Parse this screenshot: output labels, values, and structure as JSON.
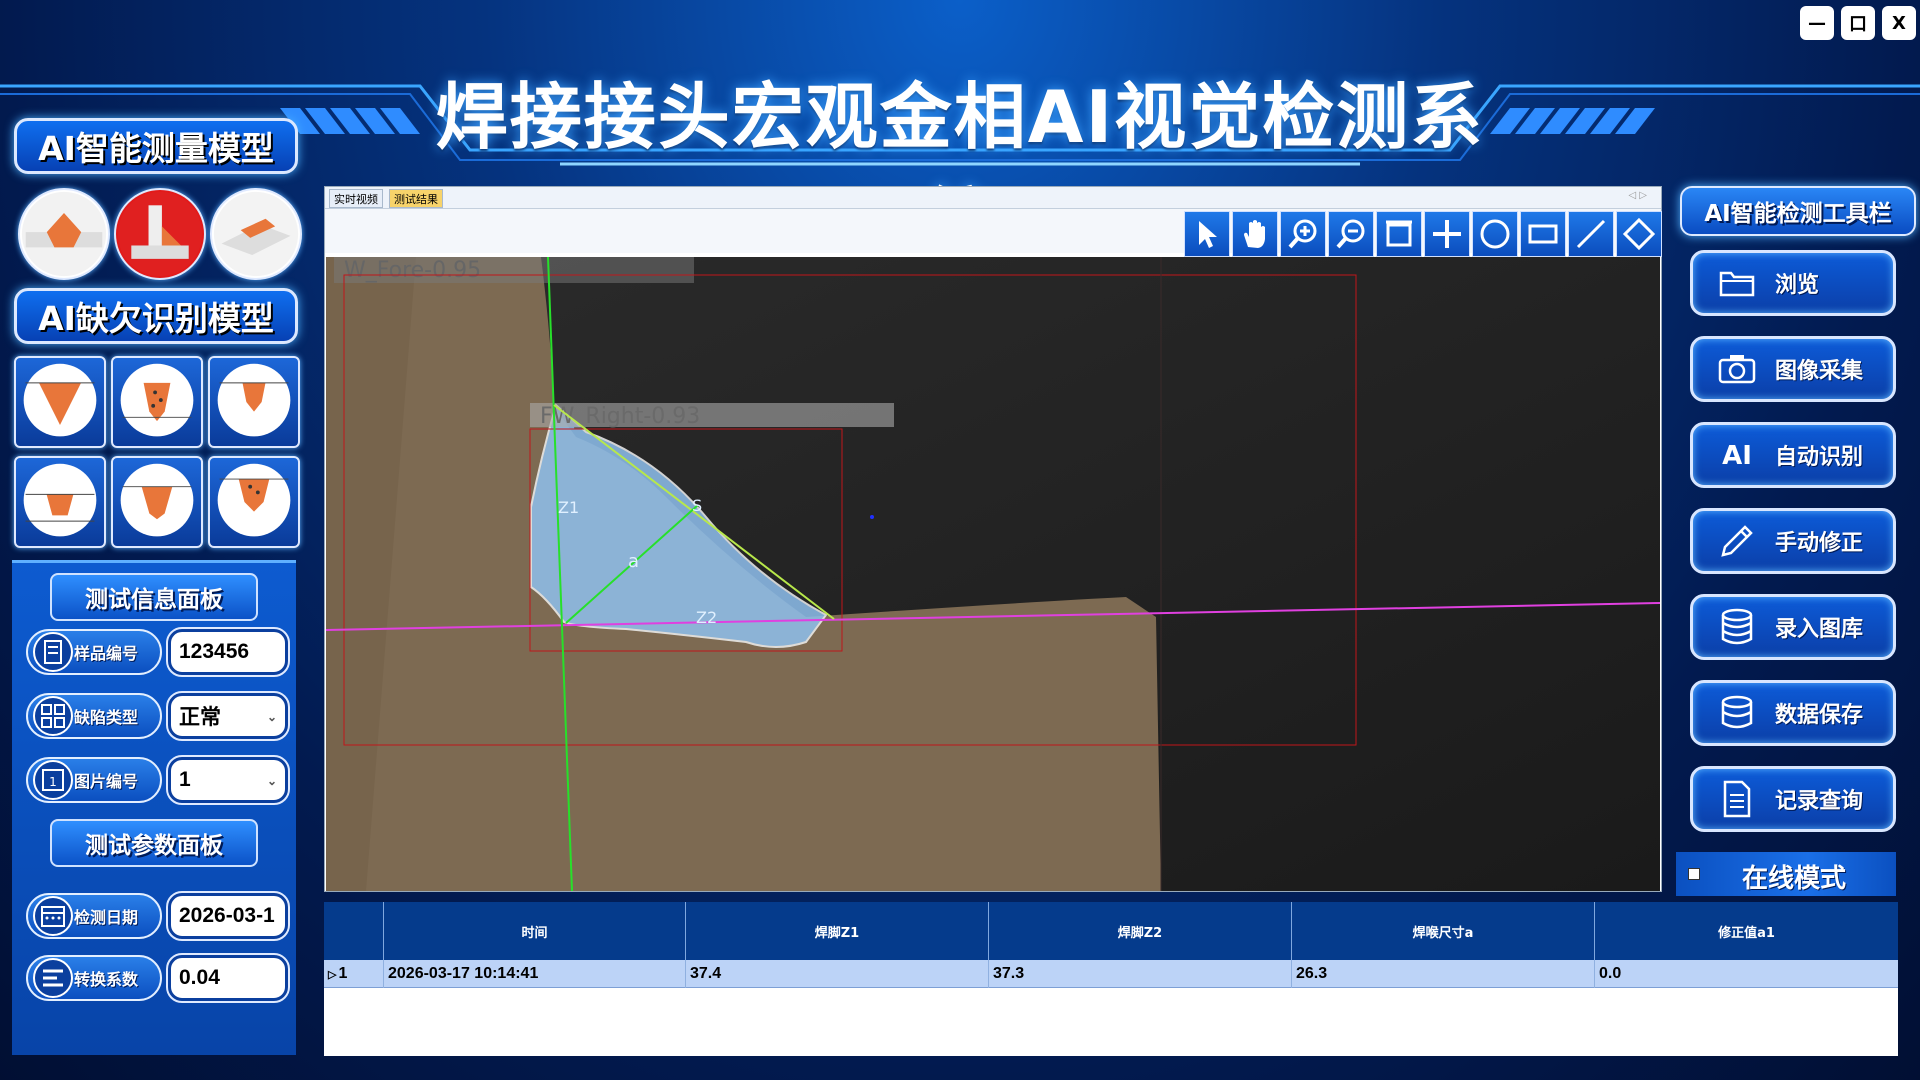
{
  "window": {
    "minimize": "—",
    "maximize": "口",
    "close": "X"
  },
  "title": "焊接接头宏观金相AI视觉检测系统",
  "left": {
    "measure_model_title": "AI智能测量模型",
    "defect_model_title": "AI缺欠识别模型",
    "info_panel_title": "测试信息面板",
    "param_panel_title": "测试参数面板",
    "fields": {
      "sample_no": {
        "label": "样品编号",
        "value": "123456"
      },
      "defect_type": {
        "label": "缺陷类型",
        "value": "正常"
      },
      "image_no": {
        "label": "图片编号",
        "value": "1"
      },
      "test_date": {
        "label": "检测日期",
        "value": "2026-03-1"
      },
      "factor": {
        "label": "转换系数",
        "value": "0.04"
      }
    }
  },
  "viewer": {
    "tabs": [
      "实时视频",
      "测试结果"
    ],
    "active_tab": "测试结果",
    "nav_arrows": "◁ ▷",
    "tools": [
      "pointer-icon",
      "hand-icon",
      "zoom-in-icon",
      "zoom-out-icon",
      "fit-window-icon",
      "crosshair-icon",
      "circle-icon",
      "rectangle-icon",
      "line-icon",
      "polygon-icon"
    ],
    "overlay": {
      "label_fore": "W_Fore-0.95",
      "label_right": "FW_Right-0.93",
      "z1": "Z1",
      "z2": "Z2",
      "s": "S",
      "a": "a"
    }
  },
  "table": {
    "columns": [
      "时间",
      "焊脚Z1",
      "焊脚Z2",
      "焊喉尺寸a",
      "修正值a1"
    ],
    "rows": [
      {
        "index": "1",
        "time": "2026-03-17 10:14:41",
        "z1": "37.4",
        "z2": "37.3",
        "a": "26.3",
        "a1": "0.0"
      }
    ]
  },
  "right": {
    "title": "AI智能检测工具栏",
    "buttons": [
      {
        "icon": "folder-icon",
        "label": "浏览"
      },
      {
        "icon": "camera-icon",
        "label": "图像采集"
      },
      {
        "icon": "ai-icon",
        "label": "自动识别",
        "icon_text": "AI"
      },
      {
        "icon": "pencil-icon",
        "label": "手动修正"
      },
      {
        "icon": "database-icon",
        "label": "录入图库"
      },
      {
        "icon": "database-save-icon",
        "label": "数据保存"
      },
      {
        "icon": "document-icon",
        "label": "记录查询"
      }
    ],
    "online_mode": "在线模式",
    "online_checked": false
  },
  "colors": {
    "accent": "#0b4dbd",
    "selection_row": "#bcd3f7",
    "mask": "#8fc0ee",
    "magenta_line": "#e040e0",
    "green_line": "#27e02a"
  }
}
